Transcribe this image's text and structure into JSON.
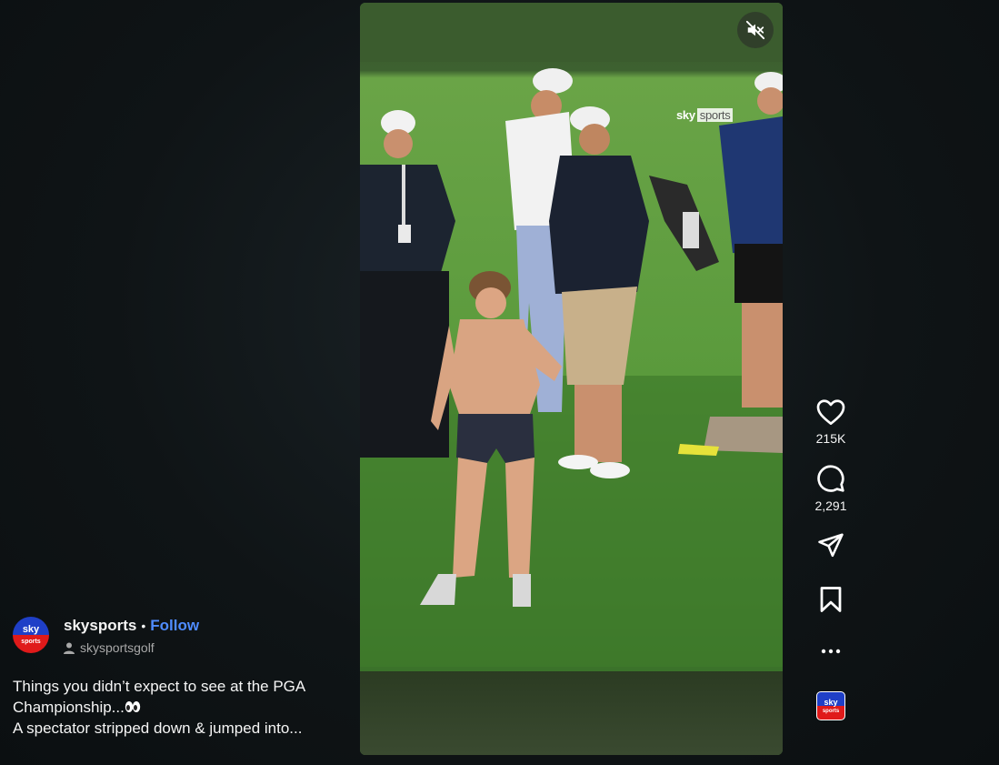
{
  "video": {
    "mute_icon": "speaker-muted-icon",
    "watermark_primary": "sky",
    "watermark_secondary": "sports"
  },
  "author": {
    "avatar_line1": "sky",
    "avatar_line2": "sports",
    "username": "skysports",
    "separator": "•",
    "follow_label": "Follow",
    "audio_label": "skysportsgolf"
  },
  "caption": {
    "line1": "Things you didn’t expect to see at the PGA",
    "line2": "Championship...",
    "line3": "A spectator stripped down & jumped into..."
  },
  "actions": {
    "like_icon": "heart-icon",
    "like_count": "215K",
    "comment_icon": "comment-icon",
    "comment_count": "2,291",
    "share_icon": "send-icon",
    "save_icon": "bookmark-icon",
    "more_icon": "more-horizontal-icon",
    "audio_thumb_line1": "sky",
    "audio_thumb_line2": "sports"
  },
  "colors": {
    "accent_follow": "#4f8cff",
    "background": "#0f1416",
    "brand_blue": "#1f3fc7",
    "brand_red": "#e01a1a"
  }
}
